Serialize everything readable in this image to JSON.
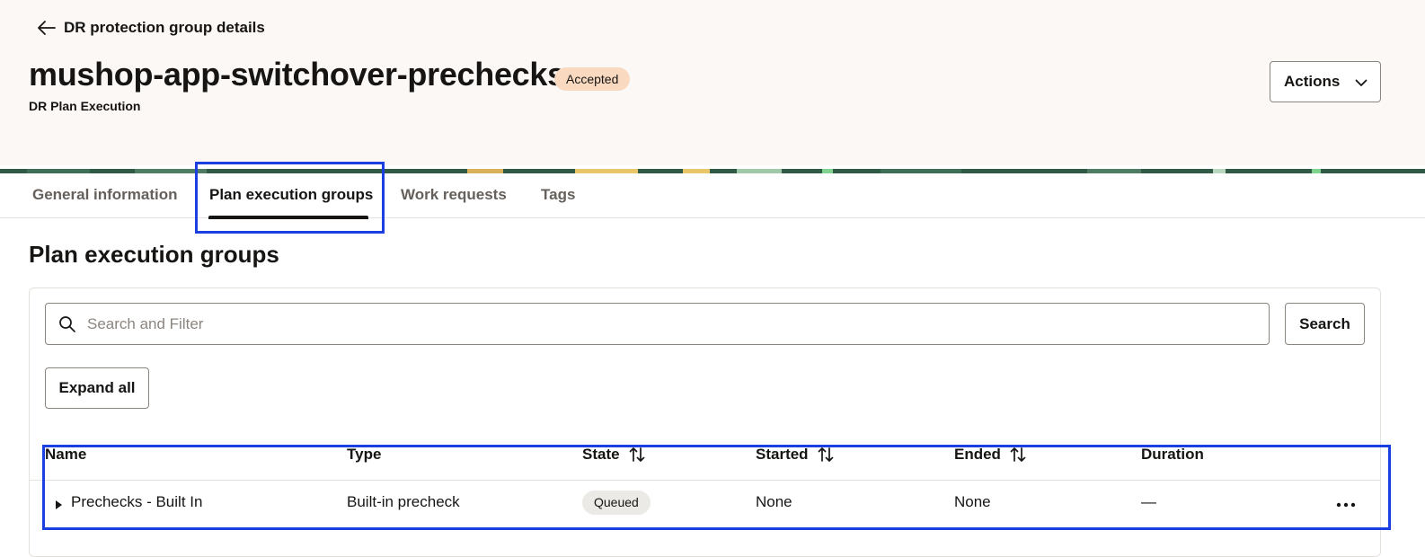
{
  "header": {
    "back_label": "DR protection group details",
    "title": "mushop-app-switchover-prechecks",
    "status_badge": "Accepted",
    "subtitle": "DR Plan Execution",
    "actions_label": "Actions"
  },
  "tabs": [
    {
      "label": "General information",
      "active": false
    },
    {
      "label": "Plan execution groups",
      "active": true
    },
    {
      "label": "Work requests",
      "active": false
    },
    {
      "label": "Tags",
      "active": false
    }
  ],
  "section": {
    "title": "Plan execution groups",
    "search_placeholder": "Search and Filter",
    "search_button": "Search",
    "expand_all_button": "Expand all"
  },
  "table": {
    "columns": [
      "Name",
      "Type",
      "State",
      "Started",
      "Ended",
      "Duration"
    ],
    "rows": [
      {
        "name": "Prechecks - Built In",
        "type": "Built-in precheck",
        "state": "Queued",
        "started": "None",
        "ended": "None",
        "duration": "—"
      }
    ]
  },
  "colors": {
    "header_bg": "#fbf8f6",
    "accepted_badge": "#f9dac1",
    "queued_badge": "#eceae7",
    "highlight_box": "#1b3fe0",
    "banner_green": "#2f5a45"
  },
  "icons": {
    "back": "arrow-left-icon",
    "actions": "chevron-down-icon",
    "search": "search-icon",
    "sort": "sort-icon",
    "expand_row": "caret-right-icon",
    "row_actions": "more-horizontal-icon"
  }
}
